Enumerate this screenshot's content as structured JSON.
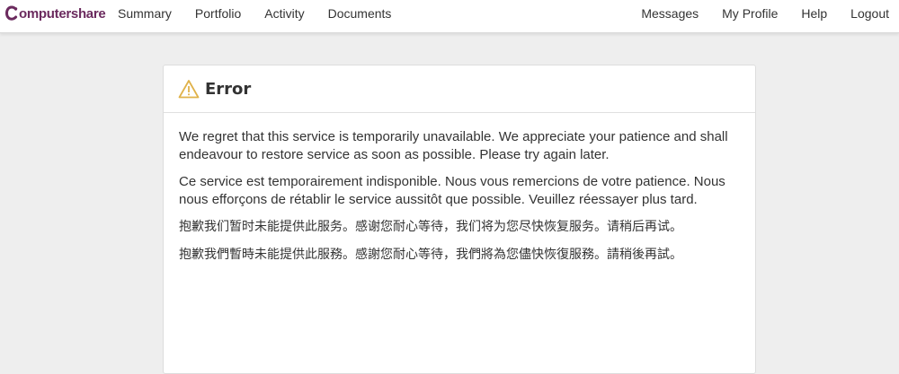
{
  "brand": {
    "name": "omputershare",
    "color": "#6b2a5e"
  },
  "nav": {
    "left": [
      "Summary",
      "Portfolio",
      "Activity",
      "Documents"
    ],
    "right": [
      "Messages",
      "My Profile",
      "Help",
      "Logout"
    ]
  },
  "panel": {
    "icon": "warning-icon",
    "title": "Error",
    "messages": {
      "en": "We regret that this service is temporarily unavailable. We appreciate your patience and shall endeavour to restore service as soon as possible. Please try again later.",
      "fr": "Ce service est temporairement indisponible. Nous vous remercions de votre patience. Nous nous efforçons de rétablir le service aussitôt que possible. Veuillez réessayer plus tard.",
      "zh_hans": "抱歉我们暂时未能提供此服务。感谢您耐心等待，我们将为您尽快恢复服务。请稍后再试。",
      "zh_hant": "抱歉我們暫時未能提供此服務。感謝您耐心等待，我們將為您儘快恢復服務。請稍後再試。"
    }
  }
}
